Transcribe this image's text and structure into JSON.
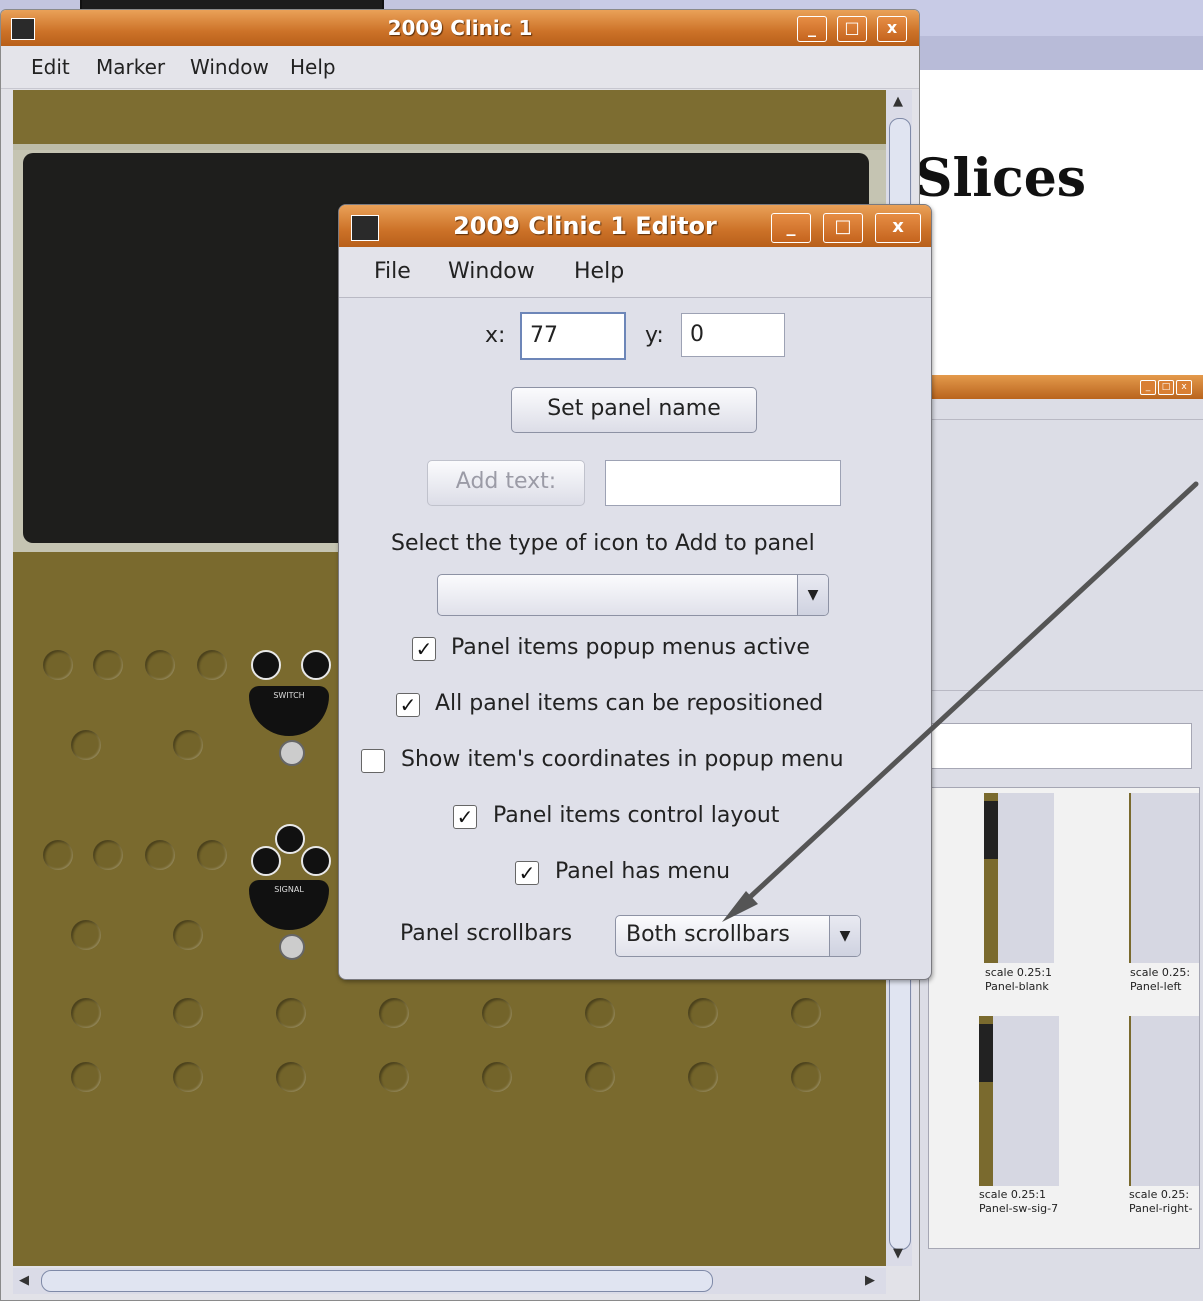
{
  "background": {
    "heading": "Slices"
  },
  "catalog": {
    "controls": {
      "minimize": "_",
      "maximize": "□",
      "close": "x"
    },
    "thumbnails": [
      {
        "scale": "scale 0.25:1",
        "name": "Panel-blank"
      },
      {
        "scale": "scale 0.25:",
        "name": "Panel-left"
      },
      {
        "scale": "scale 0.25:1",
        "name": "Panel-sw-sig-7"
      },
      {
        "scale": "scale 0.25:",
        "name": "Panel-right-"
      }
    ]
  },
  "main_window": {
    "title": "2009 Clinic 1",
    "controls": {
      "minimize": "_",
      "maximize": "□",
      "close": "x"
    },
    "menu": [
      "Edit",
      "Marker",
      "Window",
      "Help"
    ],
    "panel": {
      "switch_label": "SWITCH",
      "signal_label": "SIGNAL"
    }
  },
  "editor": {
    "title": "2009 Clinic 1 Editor",
    "controls": {
      "minimize": "_",
      "maximize": "□",
      "close": "x"
    },
    "menu": [
      "File",
      "Window",
      "Help"
    ],
    "x_label": "x:",
    "x_value": "77",
    "y_label": "y:",
    "y_value": "0",
    "set_panel_name": "Set panel name",
    "add_text_button": "Add text:",
    "add_text_value": "",
    "icon_type_label": "Select the type of icon to Add to panel",
    "icon_type_selected": "",
    "checkboxes": [
      {
        "label": "Panel items popup menus active",
        "checked": true
      },
      {
        "label": "All panel items can be repositioned",
        "checked": true
      },
      {
        "label": "Show item's coordinates in popup menu",
        "checked": false
      },
      {
        "label": "Panel items control layout",
        "checked": true
      },
      {
        "label": "Panel has menu",
        "checked": true
      }
    ],
    "scrollbars_label": "Panel scrollbars",
    "scrollbars_selected": "Both scrollbars"
  },
  "colors": {
    "titlebar": "#cc7228",
    "panel_background": "#7a6a2e",
    "annotation_arrow": "#555555"
  }
}
